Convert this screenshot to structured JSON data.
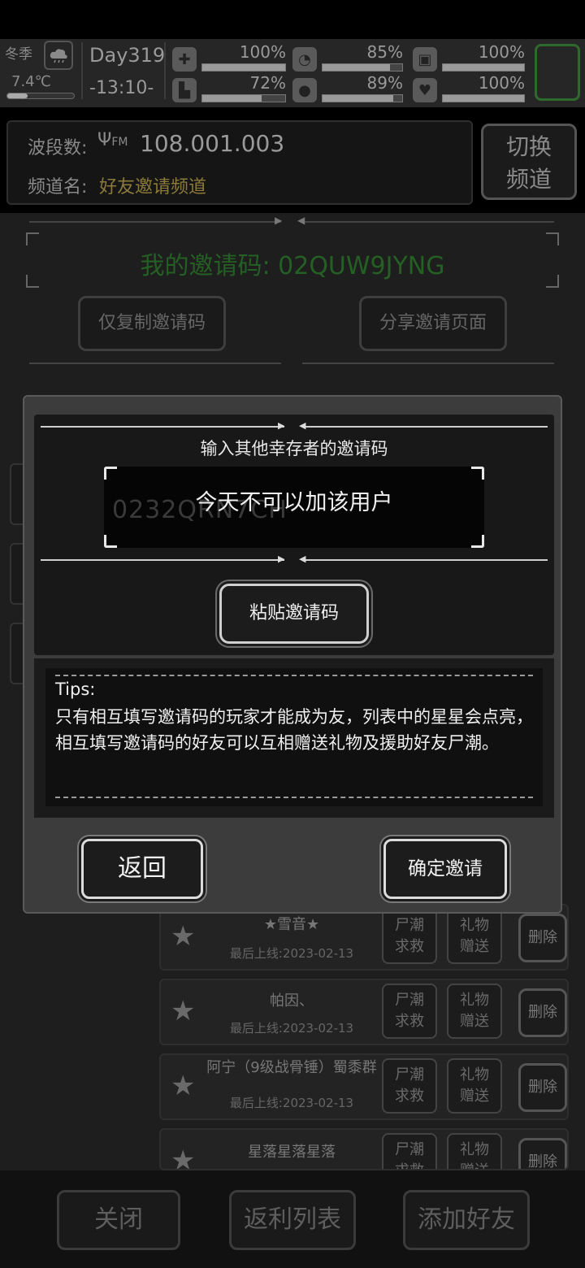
{
  "status": {
    "season": "冬季",
    "temperature": "7.4℃",
    "day": "Day319",
    "time": "-13:10-",
    "stats": [
      {
        "icon": "medkit-icon",
        "glyph": "✚",
        "value": "100%",
        "level": 1.0
      },
      {
        "icon": "hunger-icon",
        "glyph": "◔",
        "value": "85%",
        "level": 0.85
      },
      {
        "icon": "energy-icon",
        "glyph": "▣",
        "value": "100%",
        "level": 1.0
      },
      {
        "icon": "boot-icon",
        "glyph": "▙",
        "value": "72%",
        "level": 0.72
      },
      {
        "icon": "water-drop-icon",
        "glyph": "💧",
        "value": "89%",
        "level": 0.89
      },
      {
        "icon": "heart-icon",
        "glyph": "♥",
        "value": "100%",
        "level": 1.0
      }
    ]
  },
  "channel": {
    "band_label": "波段数:",
    "band_value": "108.001.003",
    "channel_label": "频道名:",
    "channel_value": "好友邀请频道",
    "switch_button": "切换\n频道"
  },
  "invite": {
    "my_code": "我的邀请码: 02QUW9JYNG",
    "copy_button": "仅复制邀请码",
    "share_button": "分享邀请页面"
  },
  "friends": [
    {
      "name": "★雪音★",
      "last_online": "最后上线:2023-02-13"
    },
    {
      "name": "帕因、",
      "last_online": "最后上线:2023-02-13"
    },
    {
      "name": "阿宁（9级战骨锤）蜀黍群",
      "last_online": "最后上线:2023-02-13"
    },
    {
      "name": "星落星落星落",
      "last_online": ""
    }
  ],
  "friend_buttons": {
    "rescue": "尸潮求救",
    "gift": "礼物赠送",
    "delete": "删除"
  },
  "bottom": {
    "close": "关闭",
    "rebate": "返利列表",
    "add_friend": "添加好友"
  },
  "modal": {
    "title": "输入其他幸存者的邀请码",
    "code_typed": "0232QRN7CH",
    "toast": "今天不可以加该用户",
    "paste_button": "粘贴邀请码",
    "tips_title": "Tips:",
    "tips_body": "只有相互填写邀请码的玩家才能成为友，列表中的星星会点亮，相互填写邀请码的好友可以互相赠送礼物及援助好友尸潮。",
    "back_button": "返回",
    "confirm_button": "确定邀请"
  }
}
